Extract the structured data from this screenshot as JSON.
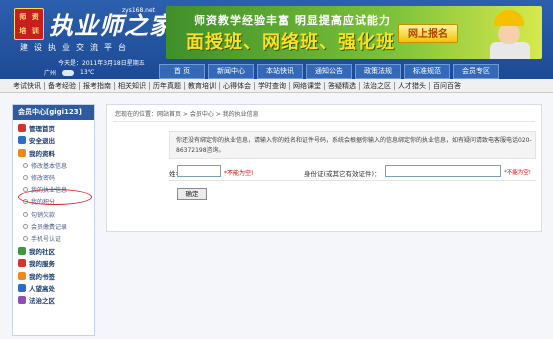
{
  "header": {
    "logo_chars": [
      "师",
      "资",
      "培",
      "训"
    ],
    "site_title": "执业师之家",
    "site_domain": "zys168.net",
    "slogan": "建设执业交流平台",
    "date": "今天是：2011年3月18日星期五",
    "city": "广州",
    "temperature": "13℃"
  },
  "banner": {
    "top_text": "师资教学经验丰富 明显提高应试能力",
    "main_text": "面授班、网络班、强化班",
    "button_label": "网上报名"
  },
  "nav": [
    "首 页",
    "新闻中心",
    "本站快讯",
    "通知公告",
    "政策法规",
    "标准规范",
    "会员专区"
  ],
  "subnav": [
    "考试快讯",
    "备考经验",
    "报考指南",
    "相关知识",
    "历年真题",
    "教育培训",
    "心得体会",
    "学时查询",
    "网络课堂",
    "答疑精选",
    "法治之区",
    "人才猎头",
    "百问百答"
  ],
  "sidebar": {
    "title": "会员中心[gigi123]",
    "items": [
      {
        "label": "管理首页",
        "kind": "head",
        "icon": "red"
      },
      {
        "label": "安全退出",
        "kind": "head",
        "icon": "blue"
      },
      {
        "label": "我的资料",
        "kind": "head",
        "icon": "orange"
      },
      {
        "label": "修改基本信息",
        "kind": "sub"
      },
      {
        "label": "修改密码",
        "kind": "sub"
      },
      {
        "label": "我的执业信息",
        "kind": "sub"
      },
      {
        "label": "我的积分",
        "kind": "sub"
      },
      {
        "label": "勾销欠款",
        "kind": "sub"
      },
      {
        "label": "会员缴费记录",
        "kind": "sub"
      },
      {
        "label": "手机号认证",
        "kind": "sub"
      },
      {
        "label": "我的社区",
        "kind": "head",
        "icon": "green"
      },
      {
        "label": "我的服务",
        "kind": "head",
        "icon": "red"
      },
      {
        "label": "我的书签",
        "kind": "head",
        "icon": "orange"
      },
      {
        "label": "人望高处",
        "kind": "head",
        "icon": "blue"
      },
      {
        "label": "法治之区",
        "kind": "head",
        "icon": "purple"
      }
    ]
  },
  "main": {
    "breadcrumb": "您现在的位置：网站首页 > 会员中心 > 我的执业信息",
    "notice": "你还没有绑定你的执业信息，请输入你的姓名和证件号码，系统会根据你输入的信息绑定你的执业信息，如有疑问请致电客服电话020-86372198咨询。",
    "name_label": "姓名：",
    "name_value": "",
    "name_required": "*不能为空!",
    "id_label": "身份证(或其它有效证件)：",
    "id_value": "",
    "id_required": "*不能为空!",
    "submit_label": "确定"
  }
}
